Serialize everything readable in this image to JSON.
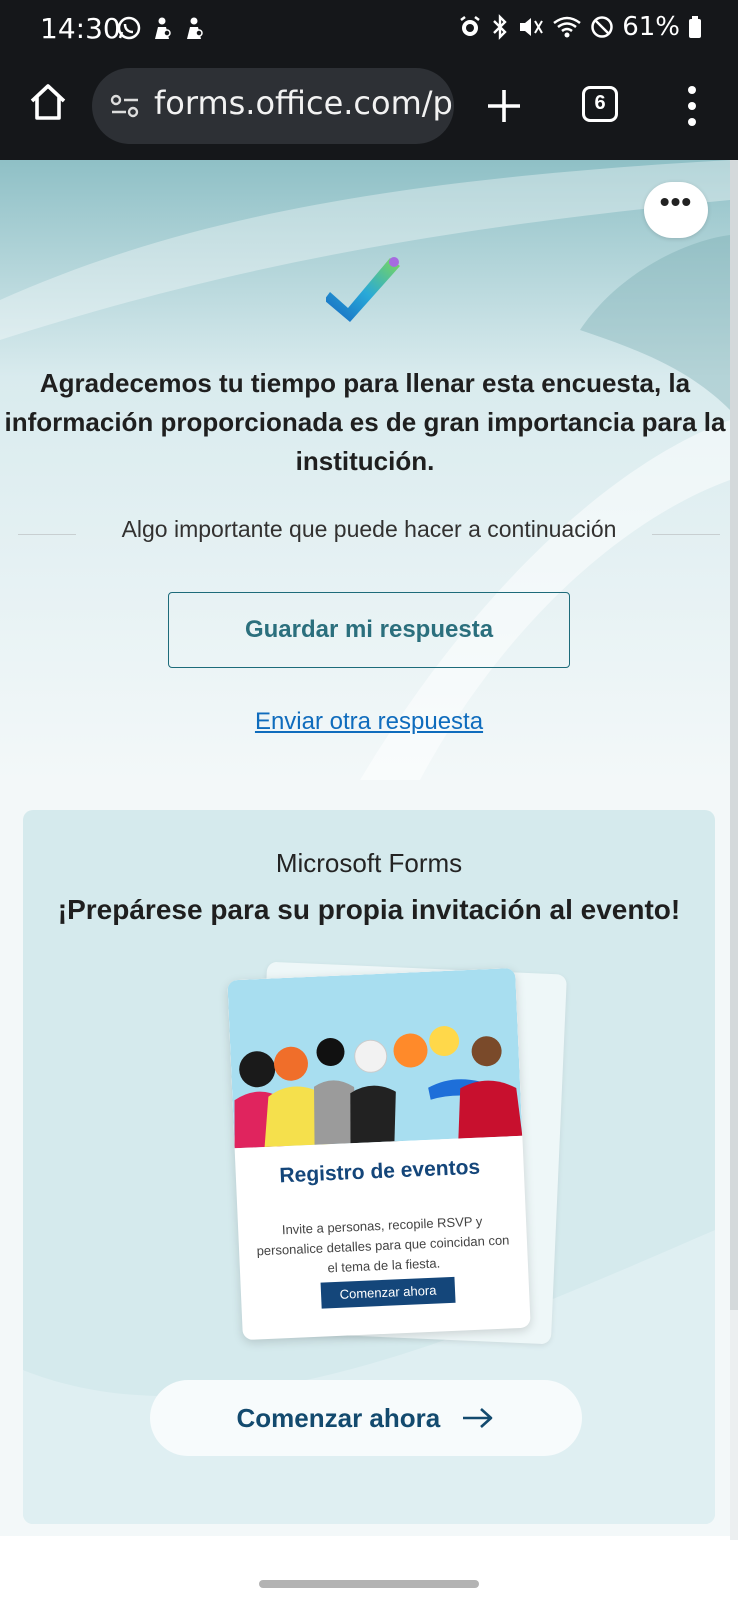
{
  "status_bar": {
    "time": "14:30",
    "battery": "61%",
    "left_icons": [
      "whatsapp-icon",
      "notification-icon",
      "notification-icon"
    ],
    "right_icons": [
      "alarm-icon",
      "bluetooth-icon",
      "mute-icon",
      "wifi-icon",
      "do-not-disturb-icon",
      "battery-icon"
    ]
  },
  "browser": {
    "url": "forms.office.com/p",
    "tab_count": "6"
  },
  "form": {
    "more_label": "•••",
    "thanks_message": "Agradecemos tu tiempo para llenar esta encuesta, la información proporcionada es de gran importancia para la institución.",
    "divider_text": "Algo importante que puede hacer a continuación",
    "save_button": "Guardar mi respuesta",
    "another_response_link": "Enviar otra respuesta"
  },
  "promo": {
    "brand": "Microsoft Forms",
    "title": "¡Prepárese para su propia invitación al evento!",
    "card": {
      "title": "Registro de eventos",
      "description": "Invite a personas, recopile RSVP y personalice detalles para que coincidan con el tema de la fiesta.",
      "button": "Comenzar ahora"
    },
    "start_button": "Comenzar ahora"
  },
  "colors": {
    "accent": "#1d6b7a",
    "link": "#0f6cbd",
    "promo_bg": "#d5eaed",
    "browser_bar": "#15171a"
  }
}
